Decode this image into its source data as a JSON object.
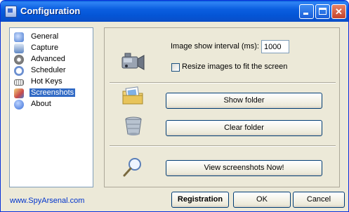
{
  "window": {
    "title": "Configuration"
  },
  "sidebar": {
    "items": [
      {
        "label": "General",
        "icon": "general-icon",
        "color": "#4a7bd0"
      },
      {
        "label": "Capture",
        "icon": "capture-icon",
        "color": "#5f86c2"
      },
      {
        "label": "Advanced",
        "icon": "advanced-icon",
        "color": "#8a8a8a"
      },
      {
        "label": "Scheduler",
        "icon": "scheduler-icon",
        "color": "#6b8fd0"
      },
      {
        "label": "Hot Keys",
        "icon": "hotkeys-icon",
        "color": "#9a9a9a"
      },
      {
        "label": "Screenshots",
        "icon": "screenshots-icon",
        "color": "#c94a4a",
        "selected": true
      },
      {
        "label": "About",
        "icon": "about-icon",
        "color": "#3b6fd8"
      }
    ]
  },
  "panel": {
    "interval_label": "Image show interval (ms):",
    "interval_value": "1000",
    "resize_label": "Resize images to fit the screen",
    "resize_checked": false,
    "show_folder": "Show folder",
    "clear_folder": "Clear folder",
    "view_now": "View screenshots Now!"
  },
  "footer": {
    "link": "www.SpyArsenal.com",
    "registration": "Registration",
    "ok": "OK",
    "cancel": "Cancel"
  }
}
